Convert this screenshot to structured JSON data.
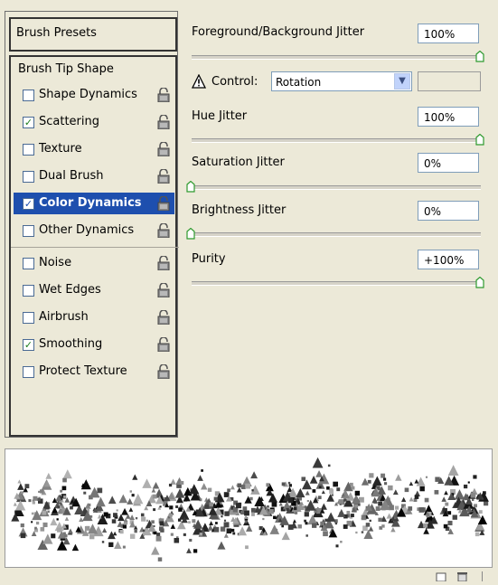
{
  "left_panel": {
    "presets_label": "Brush Presets",
    "tip_shape_label": "Brush Tip Shape",
    "items": [
      {
        "label": "Shape Dynamics",
        "checked": false,
        "selected": false
      },
      {
        "label": "Scattering",
        "checked": true,
        "selected": false
      },
      {
        "label": "Texture",
        "checked": false,
        "selected": false
      },
      {
        "label": "Dual Brush",
        "checked": false,
        "selected": false
      },
      {
        "label": "Color Dynamics",
        "checked": true,
        "selected": true
      },
      {
        "label": "Other Dynamics",
        "checked": false,
        "selected": false
      },
      {
        "label": "Noise",
        "checked": false,
        "selected": false
      },
      {
        "label": "Wet Edges",
        "checked": false,
        "selected": false
      },
      {
        "label": "Airbrush",
        "checked": false,
        "selected": false
      },
      {
        "label": "Smoothing",
        "checked": true,
        "selected": false
      },
      {
        "label": "Protect Texture",
        "checked": false,
        "selected": false
      }
    ]
  },
  "right_panel": {
    "fg_bg_jitter": {
      "label": "Foreground/Background Jitter",
      "value": "100%",
      "slider_fraction": 1.0
    },
    "control": {
      "label": "Control:",
      "selected": "Rotation"
    },
    "hue_jitter": {
      "label": "Hue Jitter",
      "value": "100%",
      "slider_fraction": 1.0
    },
    "saturation_jitter": {
      "label": "Saturation Jitter",
      "value": "0%",
      "slider_fraction": 0.0
    },
    "brightness_jitter": {
      "label": "Brightness Jitter",
      "value": "0%",
      "slider_fraction": 0.0
    },
    "purity": {
      "label": "Purity",
      "value": "+100%",
      "slider_fraction": 1.0
    }
  },
  "colors": {
    "selected_bg": "#1e4fae",
    "checkmark": "#1e7d1e",
    "panel_bg": "#ece9d8",
    "thumb_green": "#2f9a2f"
  },
  "icons": [
    "lock-icon",
    "warning-icon",
    "chevron-down-icon",
    "new-preset-icon",
    "delete-icon"
  ]
}
